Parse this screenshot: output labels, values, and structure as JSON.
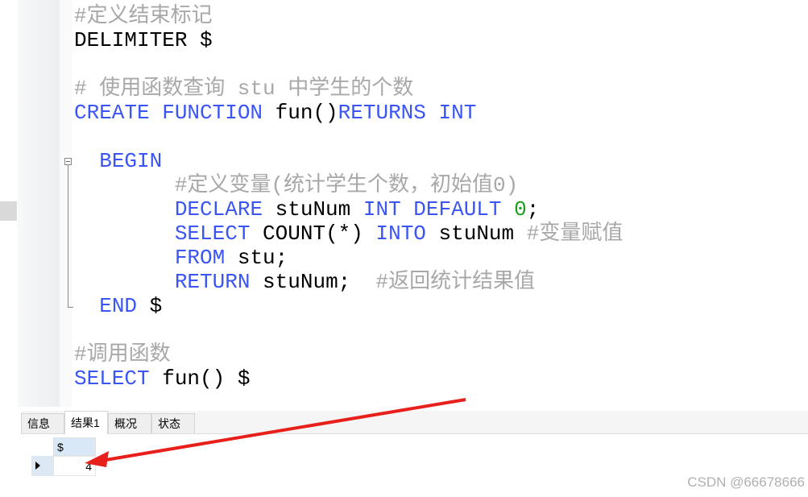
{
  "editor": {
    "lines": [
      [
        {
          "t": "#定义结束标记",
          "c": "cm"
        }
      ],
      [
        {
          "t": "DELIMITER $",
          "c": ""
        }
      ],
      [],
      [
        {
          "t": "# 使用函数查询 stu 中学生的个数",
          "c": "cm"
        }
      ],
      [
        {
          "t": "CREATE FUNCTION",
          "c": "kw"
        },
        {
          "t": " fun()",
          "c": ""
        },
        {
          "t": "RETURNS INT",
          "c": "kw"
        }
      ],
      [],
      [
        {
          "t": "  ",
          "c": ""
        },
        {
          "t": "BEGIN",
          "c": "kw"
        }
      ],
      [
        {
          "t": "        ",
          "c": ""
        },
        {
          "t": "#定义变量(统计学生个数，初始值0)",
          "c": "cm"
        }
      ],
      [
        {
          "t": "        ",
          "c": ""
        },
        {
          "t": "DECLARE",
          "c": "kw"
        },
        {
          "t": " stuNum ",
          "c": ""
        },
        {
          "t": "INT DEFAULT",
          "c": "kw"
        },
        {
          "t": " ",
          "c": ""
        },
        {
          "t": "0",
          "c": "num"
        },
        {
          "t": ";",
          "c": ""
        }
      ],
      [
        {
          "t": "        ",
          "c": ""
        },
        {
          "t": "SELECT",
          "c": "kw"
        },
        {
          "t": " COUNT(*) ",
          "c": ""
        },
        {
          "t": "INTO",
          "c": "kw"
        },
        {
          "t": " stuNum ",
          "c": ""
        },
        {
          "t": "#变量赋值",
          "c": "cm"
        }
      ],
      [
        {
          "t": "        ",
          "c": ""
        },
        {
          "t": "FROM",
          "c": "kw"
        },
        {
          "t": " stu;",
          "c": ""
        }
      ],
      [
        {
          "t": "        ",
          "c": ""
        },
        {
          "t": "RETURN",
          "c": "kw"
        },
        {
          "t": " stuNum;  ",
          "c": ""
        },
        {
          "t": "#返回统计结果值",
          "c": "cm"
        }
      ],
      [
        {
          "t": "  ",
          "c": ""
        },
        {
          "t": "END",
          "c": "kw"
        },
        {
          "t": " $",
          "c": ""
        }
      ],
      [],
      [
        {
          "t": "#调用函数",
          "c": "cm"
        }
      ],
      [
        {
          "t": "SELECT",
          "c": "kw"
        },
        {
          "t": " fun() $",
          "c": ""
        }
      ]
    ]
  },
  "tabs": [
    {
      "label": "信息",
      "active": false
    },
    {
      "label": "结果1",
      "active": true
    },
    {
      "label": "概况",
      "active": false
    },
    {
      "label": "状态",
      "active": false
    }
  ],
  "result": {
    "column": "$",
    "value": "4"
  },
  "watermark": "CSDN @66678666",
  "colors": {
    "keyword": "#3b55f5",
    "comment": "#a8a8a8",
    "number": "#1a9e1a",
    "arrow": "#e8201c"
  }
}
